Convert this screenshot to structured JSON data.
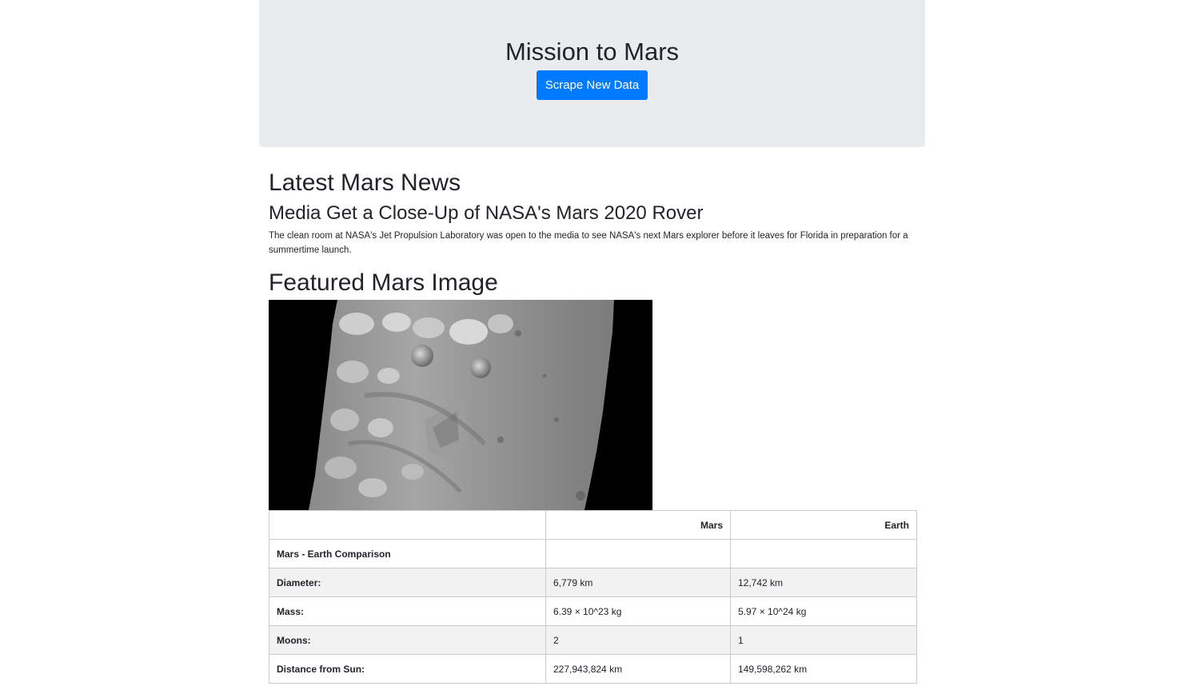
{
  "header": {
    "title": "Mission to Mars",
    "scrape_button_label": "Scrape New Data"
  },
  "news": {
    "section_title": "Latest Mars News",
    "title": "Media Get a Close-Up of NASA's Mars 2020 Rover",
    "paragraph": "The clean room at NASA's Jet Propulsion Laboratory was open to the media to see NASA's next Mars explorer before it leaves for Florida in preparation for a summertime launch."
  },
  "featured_image": {
    "section_title": "Featured Mars Image"
  },
  "facts_table": {
    "headers": [
      "",
      "Mars",
      "Earth"
    ],
    "rows": [
      {
        "label": "Mars - Earth Comparison",
        "mars": "",
        "earth": ""
      },
      {
        "label": "Diameter:",
        "mars": "6,779 km",
        "earth": "12,742 km"
      },
      {
        "label": "Mass:",
        "mars": "6.39 × 10^23 kg",
        "earth": "5.97 × 10^24 kg"
      },
      {
        "label": "Moons:",
        "mars": "2",
        "earth": "1"
      },
      {
        "label": "Distance from Sun:",
        "mars": "227,943,824 km",
        "earth": "149,598,262 km"
      }
    ]
  },
  "colors": {
    "jumbotron_bg": "#e9ecef",
    "button_primary": "#007bff",
    "text": "#212529",
    "table_stripe": "#f2f2f2"
  }
}
